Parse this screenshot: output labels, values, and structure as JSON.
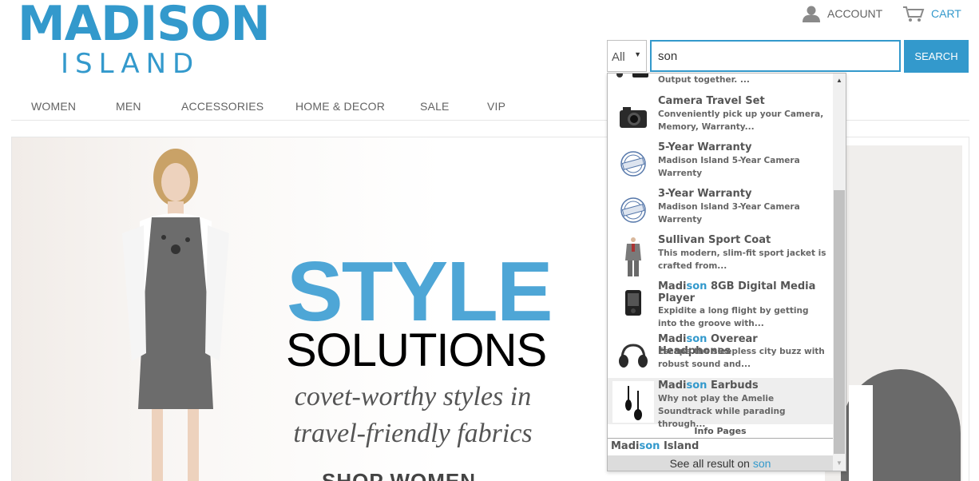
{
  "brand": {
    "line1": "MADISON",
    "line2": "ISLAND",
    "color": "#3399cc"
  },
  "header": {
    "account_label": "ACCOUNT",
    "account_icon": "user-icon",
    "cart_label": "CART",
    "cart_icon": "cart-icon"
  },
  "nav": {
    "items": [
      "WOMEN",
      "MEN",
      "ACCESSORIES",
      "HOME & DECOR",
      "SALE",
      "VIP"
    ]
  },
  "search": {
    "category": "All",
    "query": "son",
    "button_label": "SEARCH"
  },
  "autocomplete": {
    "results": [
      {
        "pre": "",
        "hl": "",
        "post": "",
        "desc": "Output together. ...",
        "icon": "headphones-icon"
      },
      {
        "pre": "Camera Travel Set",
        "hl": "",
        "post": "",
        "desc": "Conveniently pick up your Camera, Memory, Warranty...",
        "icon": "camera-icon"
      },
      {
        "pre": "5-Year Warranty",
        "hl": "",
        "post": "",
        "desc": "Madison Island 5-Year Camera Warrenty",
        "icon": "warranty-stamp-icon"
      },
      {
        "pre": "3-Year Warranty",
        "hl": "",
        "post": "",
        "desc": "Madison Island 3-Year Camera Warrenty",
        "icon": "warranty-stamp-icon"
      },
      {
        "pre": "Sullivan Sport Coat",
        "hl": "",
        "post": "",
        "desc": "This modern, slim-fit sport jacket is crafted from...",
        "icon": "suit-icon"
      },
      {
        "pre": "Madi",
        "hl": "son",
        "post": " 8GB Digital Media Player",
        "desc": "Expidite a long flight by getting into the groove with...",
        "icon": "media-player-icon"
      },
      {
        "pre": "Madi",
        "hl": "son",
        "post": " Overear Headphones",
        "desc": "Escape the sleepless city buzz with robust sound and...",
        "icon": "headphones-icon"
      },
      {
        "pre": "Madi",
        "hl": "son",
        "post": " Earbuds",
        "desc": "Why not play the Amelie Soundtrack while parading through...",
        "icon": "earbuds-icon"
      }
    ],
    "info_pages_header": "Info Pages",
    "info_page": {
      "pre": "Madi",
      "hl": "son",
      "post": " Island"
    },
    "see_all": {
      "pre": "See all result on ",
      "hl": "son"
    },
    "highlight_color": "#3399cc"
  },
  "banner": {
    "title": "STYLE",
    "subtitle": "SOLUTIONS",
    "tagline_line1": "covet-worthy styles in",
    "tagline_line2": "travel-friendly fabrics",
    "cta": "SHOP WOMEN",
    "title_color": "#4ea6d6"
  }
}
